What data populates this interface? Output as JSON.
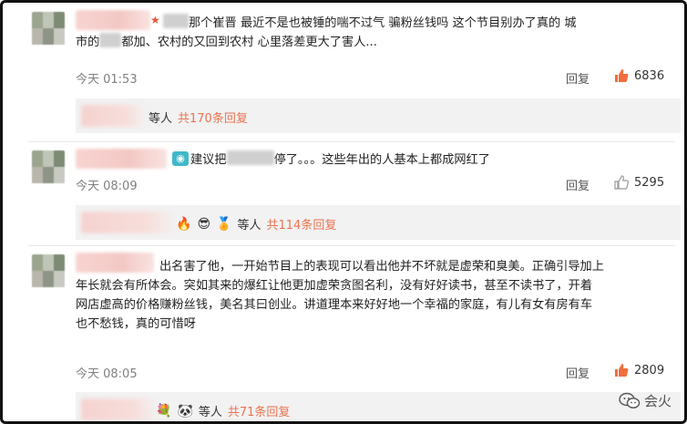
{
  "comments": [
    {
      "text_line1_a": "那个崔晋 最近不是也被锤的喘不过气 骗粉丝钱吗 这个节目别办了真的 城",
      "text_line2_a": "市的",
      "text_line2_b": "都加、农村的又回到农村 心里落差更大了害人...",
      "time": "今天 01:53",
      "reply": "回复",
      "likes": "6836",
      "sub_suffix": "等人",
      "sub_count": "共170条回复"
    },
    {
      "text_a": "建议把",
      "text_b": "停了。。。这些年出的人基本上都成网红了",
      "time": "今天 08:09",
      "reply": "回复",
      "likes": "5295",
      "sub_suffix": "等人",
      "sub_count": "共114条回复"
    },
    {
      "text_line1": "出名害了他，一开始节目上的表现可以看出他并不坏就是虚荣和臭美。正确引导加上",
      "text_line2": "年长就会有所体会。突如其来的爆红让他更加虚荣贪图名利，没有好好读书，甚至不读书了，开着",
      "text_line3": "网店虚高的价格赚粉丝钱，美名其曰创业。讲道理本来好好地一个幸福的家庭，有儿有女有房有车",
      "text_line4": "也不愁钱，真的可惜呀",
      "time": "今天 08:05",
      "reply": "回复",
      "likes": "2809",
      "sub_suffix": "等人",
      "sub_count": "共71条回复"
    }
  ],
  "watermark": {
    "text": "会火"
  },
  "colors": {
    "accent_orange": "#eb7350",
    "liked_thumb": "#f26d3d",
    "unliked_thumb": "#999999"
  }
}
